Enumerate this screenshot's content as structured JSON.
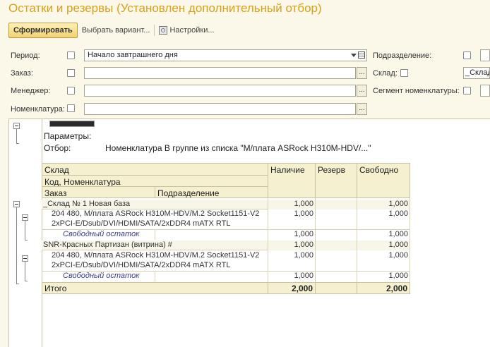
{
  "window_title": "Остатки и резервы (Установлен дополнительный отбор)",
  "toolbar": {
    "generate_label": "Сформировать",
    "choose_variant_label": "Выбрать вариант...",
    "settings_label": "Настройки..."
  },
  "filters": {
    "period": {
      "label": "Период:",
      "value": "Начало завтрашнего дня"
    },
    "order": {
      "label": "Заказ:"
    },
    "manager": {
      "label": "Менеджер:"
    },
    "nomenclature": {
      "label": "Номенклатура:"
    },
    "division": {
      "label": "Подразделение:"
    },
    "warehouse": {
      "label": "Склад:",
      "value": "_Склад"
    },
    "segment": {
      "label": "Сегмент номенклатуры:"
    }
  },
  "report": {
    "params_label": "Параметры:",
    "filter_label": "Отбор:",
    "filter_value": "Номенклатура В группе из списка \"М/плата ASRock H310M-HDV/...\"",
    "headers": {
      "warehouse": "Склад",
      "code_nomenclature": "Код, Номенклатура",
      "order": "Заказ",
      "division": "Подразделение",
      "available": "Наличие",
      "reserve": "Резерв",
      "free": "Свободно"
    },
    "rows": [
      {
        "type": "group",
        "name": "_Склад № 1 Новая база",
        "available": "1,000",
        "reserve": "",
        "free": "1,000"
      },
      {
        "type": "item",
        "line1": "204 480, М/плата ASRock H310M-HDV/M.2 Socket1151-V2",
        "line2": "2xPCI-E/Dsub/DVI/HDMI/SATA/2xDDR4 mATX RTL",
        "available": "1,000",
        "reserve": "",
        "free": "1,000"
      },
      {
        "type": "detail",
        "name": "Свободный остаток",
        "available": "1,000",
        "reserve": "",
        "free": "1,000"
      },
      {
        "type": "group",
        "name": "SNR-Красных Партизан (витрина) #",
        "available": "1,000",
        "reserve": "",
        "free": "1,000"
      },
      {
        "type": "item",
        "line1": "204 480, М/плата ASRock H310M-HDV/M.2 Socket1151-V2",
        "line2": "2xPCI-E/Dsub/DVI/HDMI/SATA/2xDDR4 mATX RTL",
        "available": "1,000",
        "reserve": "",
        "free": "1,000"
      },
      {
        "type": "detail",
        "name": "Свободный остаток",
        "available": "1,000",
        "reserve": "",
        "free": "1,000"
      }
    ],
    "total": {
      "label": "Итого",
      "available": "2,000",
      "reserve": "",
      "free": "2,000"
    }
  }
}
